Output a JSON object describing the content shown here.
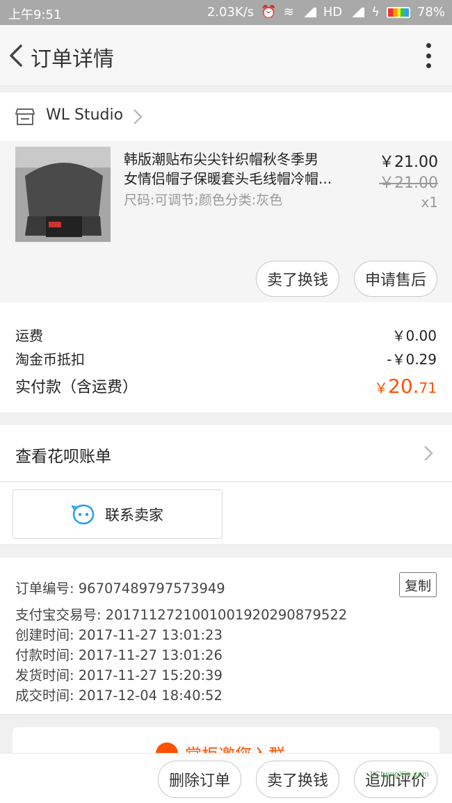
{
  "status_bar": {
    "time": "上午9:51",
    "net_speed": "2.03K/s",
    "hd": "HD",
    "battery": "78%"
  },
  "nav": {
    "title": "订单详情",
    "icons": [
      "back-arrow-icon",
      "more-vertical-icon"
    ]
  },
  "shop": {
    "name": "WL Studio",
    "icon": "store-icon"
  },
  "item": {
    "title_line1": "韩版潮贴布尖尖针织帽秋冬季男",
    "title_line2": "女情侣帽子保暖套头毛线帽冷帽...",
    "sku": "尺码:可调节;颜色分类:灰色",
    "price": "￥21.00",
    "original_price": "￥21.00",
    "quantity": "x1",
    "btn_sell": "卖了换钱",
    "btn_aftersale": "申请售后"
  },
  "fees": {
    "shipping_label": "运费",
    "shipping_value": "￥0.00",
    "coin_label": "淘金币抵扣",
    "coin_value": "-￥0.29",
    "paid_label": "实付款（含运费）",
    "paid_symbol": "￥",
    "paid_int": "20.",
    "paid_dec": "71"
  },
  "huabei": {
    "label": "查看花呗账单"
  },
  "contact": {
    "label": "联系卖家"
  },
  "order_info": {
    "order_no": "订单编号: 96707489797573949",
    "copy_label": "复制",
    "alipay_no": "支付宝交易号: 2017112721001001920290879522",
    "created": "创建时间: 2017-11-27 13:01:23",
    "paid": "付款时间: 2017-11-27 13:01:26",
    "shipped": "发货时间: 2017-11-27 15:20:39",
    "completed": "成交时间: 2017-12-04 18:40:52"
  },
  "promo": {
    "text": "掌柜邀您入群"
  },
  "bottom": {
    "delete": "删除订单",
    "sell": "卖了换钱",
    "review": "追加评价"
  },
  "watermark": "JiChengXin.com",
  "colors": {
    "accent": "#ff5000",
    "status_bar": "#a9a9a9"
  }
}
